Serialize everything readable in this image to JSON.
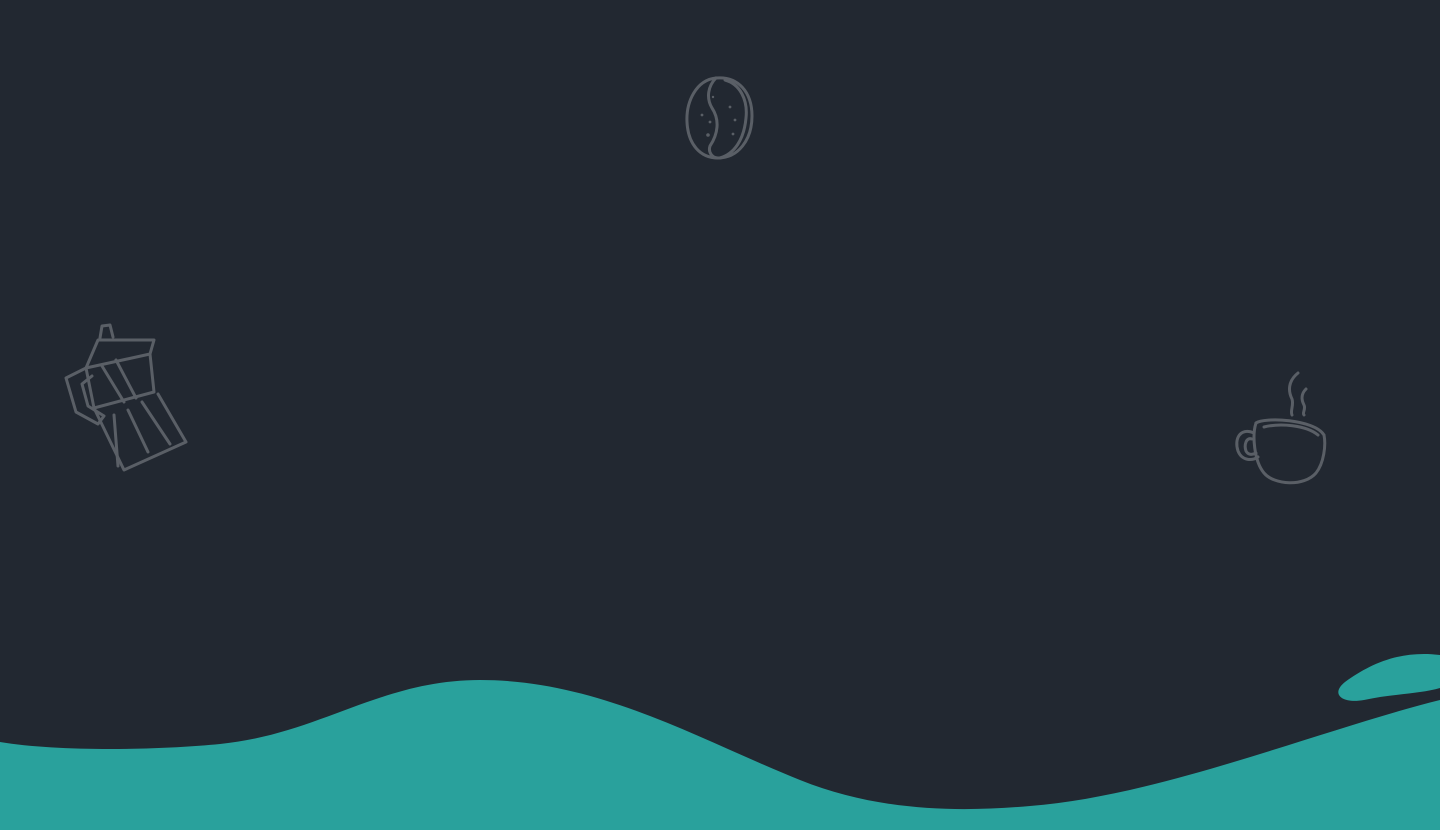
{
  "colors": {
    "background": "#222831",
    "wave": "#29a19c",
    "doodle_stroke": "#5a5f66"
  },
  "icons": {
    "bean": "coffee-bean-icon",
    "moka": "moka-pot-icon",
    "cup": "coffee-cup-icon"
  }
}
